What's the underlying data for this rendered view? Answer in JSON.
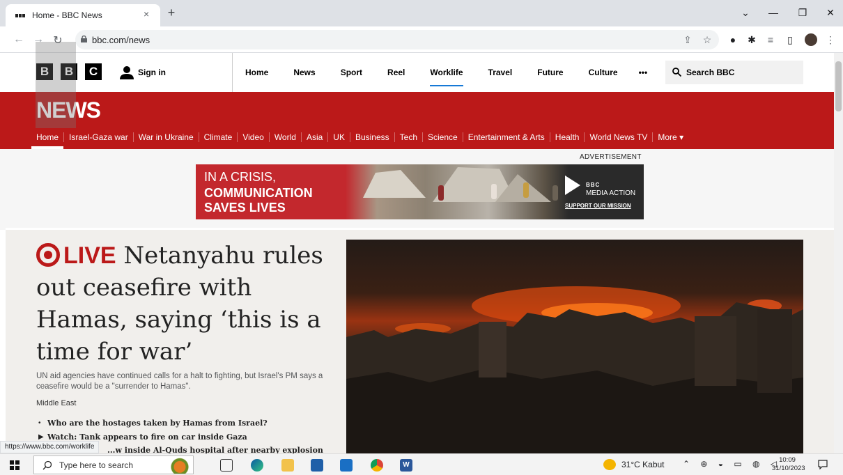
{
  "browser": {
    "tab_title": "Home - BBC News",
    "tab_close": "×",
    "new_tab": "+",
    "url": "bbc.com/news",
    "window_controls": [
      "⌄",
      "—",
      "❐",
      "✕"
    ]
  },
  "header": {
    "logo_letters": [
      "B",
      "B",
      "C"
    ],
    "signin": "Sign in",
    "nav": [
      "Home",
      "News",
      "Sport",
      "Reel",
      "Worklife",
      "Travel",
      "Future",
      "Culture"
    ],
    "more_dots": "•••",
    "search_label": "Search BBC"
  },
  "news": {
    "logo": "NEWS",
    "subnav": [
      "Home",
      "Israel-Gaza war",
      "War in Ukraine",
      "Climate",
      "Video",
      "World",
      "Asia",
      "UK",
      "Business",
      "Tech",
      "Science",
      "Entertainment & Arts",
      "Health",
      "World News TV",
      "More ▾"
    ]
  },
  "ad": {
    "label": "ADVERTISEMENT",
    "line1": "IN A CRISIS,",
    "line2": "COMMUNICATION",
    "line3": "SAVES LIVES",
    "brand": "BBC",
    "brand_sub": "MEDIA ACTION",
    "cta": "SUPPORT OUR MISSION"
  },
  "story": {
    "live": "LIVE",
    "headline": "Netanyahu rules out ceasefire with Hamas, saying ‘this is a time for war’",
    "summary": "UN aid agencies have continued calls for a halt to fighting, but Israel's PM says a ceasefire would be a \"surrender to Hamas\".",
    "section": "Middle East",
    "related": [
      {
        "marker": "•",
        "text": "Who are the hostages taken by Hamas from Israel?"
      },
      {
        "marker": "▶",
        "text": "Watch: Tank appears to fire on car inside Gaza"
      },
      {
        "marker": "",
        "text": "...w inside Al-Quds hospital after nearby explosion"
      }
    ]
  },
  "status_url": "https://www.bbc.com/worklife",
  "taskbar": {
    "search_placeholder": "Type here to search",
    "weather": "31°C  Kabut",
    "time": "10:09",
    "date": "31/10/2023"
  },
  "colors": {
    "bbc_red": "#bb1919",
    "worklife_underline": "#1779d6"
  }
}
